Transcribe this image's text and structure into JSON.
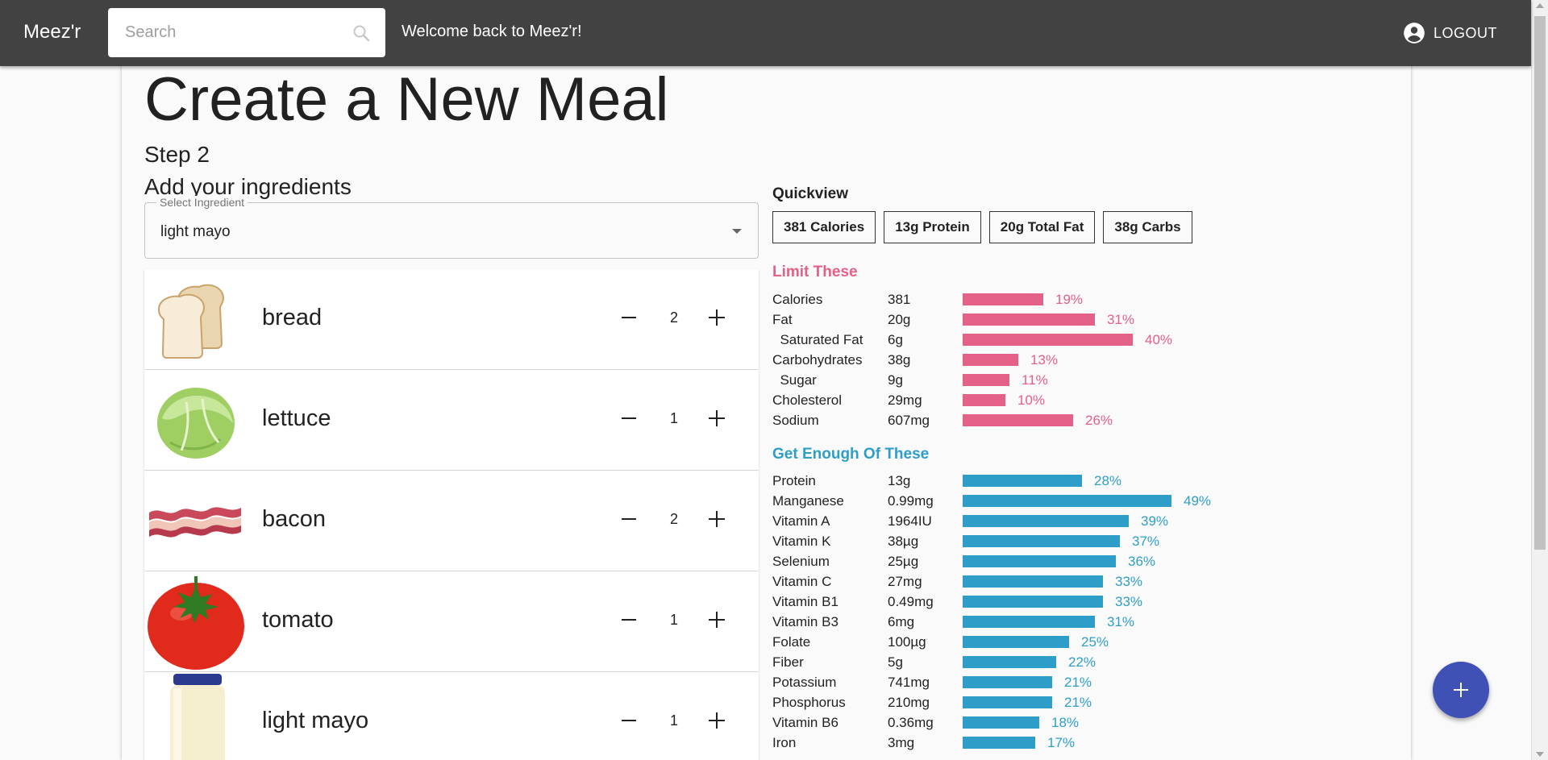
{
  "appbar": {
    "brand": "Meez'r",
    "search_placeholder": "Search",
    "welcome": "Welcome back to Meez'r!",
    "logout_label": "LOGOUT"
  },
  "page": {
    "title": "Create a New Meal",
    "step": "Step 2",
    "subtitle": "Add your ingredients"
  },
  "select": {
    "legend": "Select Ingredient",
    "value": "light mayo"
  },
  "ingredients": [
    {
      "name": "bread",
      "qty": "2"
    },
    {
      "name": "lettuce",
      "qty": "1"
    },
    {
      "name": "bacon",
      "qty": "2"
    },
    {
      "name": "tomato",
      "qty": "1"
    },
    {
      "name": "light mayo",
      "qty": "1"
    }
  ],
  "quickview": {
    "title": "Quickview",
    "chips": [
      "381 Calories",
      "13g Protein",
      "20g Total Fat",
      "38g Carbs"
    ]
  },
  "colors": {
    "limit": "#e36086",
    "enough": "#2e9ec9",
    "fab": "#3f51b5"
  },
  "limit": {
    "title": "Limit These",
    "rows": [
      {
        "label": "Calories",
        "value": "381",
        "pct": 19,
        "pct_label": "19%"
      },
      {
        "label": "Fat",
        "value": "20g",
        "pct": 31,
        "pct_label": "31%"
      },
      {
        "label": "  Saturated Fat",
        "value": "6g",
        "pct": 40,
        "pct_label": "40%"
      },
      {
        "label": "Carbohydrates",
        "value": "38g",
        "pct": 13,
        "pct_label": "13%"
      },
      {
        "label": "  Sugar",
        "value": "9g",
        "pct": 11,
        "pct_label": "11%"
      },
      {
        "label": "Cholesterol",
        "value": "29mg",
        "pct": 10,
        "pct_label": "10%"
      },
      {
        "label": "Sodium",
        "value": "607mg",
        "pct": 26,
        "pct_label": "26%"
      }
    ]
  },
  "enough": {
    "title": "Get Enough Of These",
    "rows": [
      {
        "label": "Protein",
        "value": "13g",
        "pct": 28,
        "pct_label": "28%"
      },
      {
        "label": "Manganese",
        "value": "0.99mg",
        "pct": 49,
        "pct_label": "49%"
      },
      {
        "label": "Vitamin A",
        "value": "1964IU",
        "pct": 39,
        "pct_label": "39%"
      },
      {
        "label": "Vitamin K",
        "value": "38µg",
        "pct": 37,
        "pct_label": "37%"
      },
      {
        "label": "Selenium",
        "value": "25µg",
        "pct": 36,
        "pct_label": "36%"
      },
      {
        "label": "Vitamin C",
        "value": "27mg",
        "pct": 33,
        "pct_label": "33%"
      },
      {
        "label": "Vitamin B1",
        "value": "0.49mg",
        "pct": 33,
        "pct_label": "33%"
      },
      {
        "label": "Vitamin B3",
        "value": "6mg",
        "pct": 31,
        "pct_label": "31%"
      },
      {
        "label": "Folate",
        "value": "100µg",
        "pct": 25,
        "pct_label": "25%"
      },
      {
        "label": "Fiber",
        "value": "5g",
        "pct": 22,
        "pct_label": "22%"
      },
      {
        "label": "Potassium",
        "value": "741mg",
        "pct": 21,
        "pct_label": "21%"
      },
      {
        "label": "Phosphorus",
        "value": "210mg",
        "pct": 21,
        "pct_label": "21%"
      },
      {
        "label": "Vitamin B6",
        "value": "0.36mg",
        "pct": 18,
        "pct_label": "18%"
      },
      {
        "label": "Iron",
        "value": "3mg",
        "pct": 17,
        "pct_label": "17%"
      }
    ]
  }
}
